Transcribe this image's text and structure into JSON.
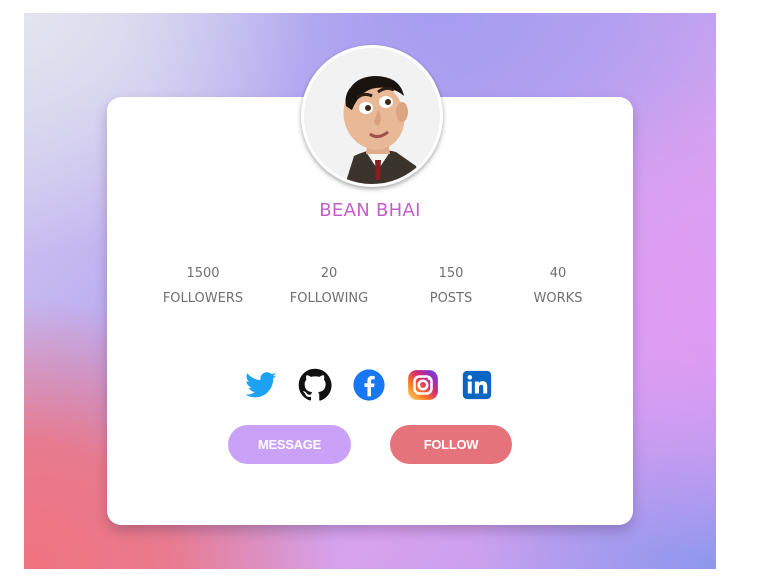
{
  "profile": {
    "name": "BEAN BHAI"
  },
  "stats": [
    {
      "value": "1500",
      "label": "FOLLOWERS"
    },
    {
      "value": "20",
      "label": "FOLLOWING"
    },
    {
      "value": "150",
      "label": "POSTS"
    },
    {
      "value": "40",
      "label": "WORKS"
    }
  ],
  "socials": [
    {
      "icon": "twitter-icon",
      "color": "#1da1f2"
    },
    {
      "icon": "github-icon",
      "color": "#111111"
    },
    {
      "icon": "facebook-icon",
      "color": "#1877f2"
    },
    {
      "icon": "instagram-icon",
      "color": "#e1306c"
    },
    {
      "icon": "linkedin-icon",
      "color": "#0a66c2"
    }
  ],
  "actions": {
    "message_label": "MESSAGE",
    "follow_label": "FOLLOW"
  },
  "colors": {
    "name_accent": "#c35fcc",
    "message_button": "#c9a2f7",
    "follow_button": "#e5737c"
  }
}
